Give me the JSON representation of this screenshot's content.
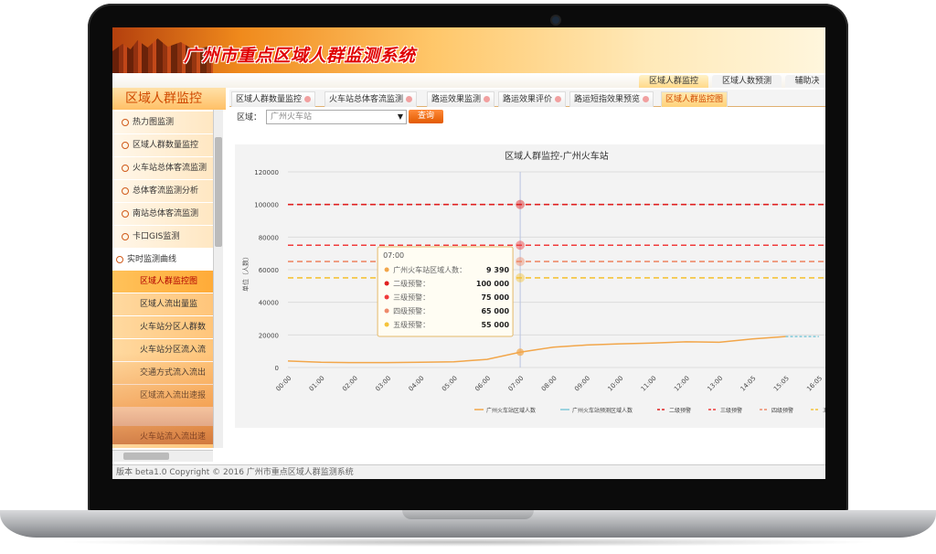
{
  "app": {
    "title": "广州市重点区域人群监测系统",
    "footer": "版本 beta1.0  Copyright © 2016 广州市重点区域人群监测系统"
  },
  "topnav": [
    "区域人群监控",
    "区域人数预测",
    "辅助决"
  ],
  "sidebar": {
    "title": "区域人群监控",
    "items": [
      {
        "label": "热力图监测"
      },
      {
        "label": "区域人群数量监控"
      },
      {
        "label": "火车站总体客流监测"
      },
      {
        "label": "总体客流监测分析"
      },
      {
        "label": "南站总体客流监测"
      },
      {
        "label": "卡口GIS监测"
      },
      {
        "label": "实时监测曲线"
      }
    ],
    "subitems": [
      {
        "label": "区域人群监控图"
      },
      {
        "label": "区域人流出量监"
      },
      {
        "label": "火车站分区人群数"
      },
      {
        "label": "火车站分区流入流"
      },
      {
        "label": "交通方式流入流出"
      },
      {
        "label": "区域流入流出速报"
      },
      {
        "label": "火车站流入流出速"
      }
    ]
  },
  "tabs": [
    "区域人群数量监控",
    "火车站总体客流监测",
    "路运效果监测",
    "路运效果评价",
    "路运短指效果预览",
    "区域人群监控图"
  ],
  "filter": {
    "label": "区域：",
    "value": "广州火车站",
    "button": "查询"
  },
  "chart_data": {
    "type": "line",
    "title": "区域人群监控-广州火车站",
    "ylabel": "单位（人数）",
    "ylim": [
      0,
      120000
    ],
    "yticks": [
      "120000",
      "100000",
      "80000",
      "60000",
      "40000",
      "20000",
      "0"
    ],
    "x": [
      "00:00",
      "01:00",
      "02:00",
      "03:00",
      "04:00",
      "05:00",
      "06:00",
      "07:00",
      "08:00",
      "09:00",
      "10:00",
      "11:00",
      "12:00",
      "13:00",
      "14:05",
      "15:05",
      "16:05"
    ],
    "series": [
      {
        "name": "广州火车站区域人数",
        "color": "#f2a64a",
        "values": [
          4000,
          3200,
          3000,
          3000,
          3200,
          3500,
          5000,
          9390,
          12500,
          13800,
          14500,
          15000,
          15800,
          15500,
          17500,
          19000,
          null
        ]
      },
      {
        "name": "广州火车站预测区域人数",
        "color": "#7ec8d8",
        "values": [
          null,
          null,
          null,
          null,
          null,
          null,
          null,
          null,
          null,
          null,
          null,
          null,
          null,
          null,
          null,
          19000,
          19000
        ]
      }
    ],
    "thresholds": [
      {
        "name": "二级预警",
        "value": 100000,
        "color": "#e02020"
      },
      {
        "name": "三级预警",
        "value": 75000,
        "color": "#f03a3a"
      },
      {
        "name": "四级预警",
        "value": 65000,
        "color": "#ee8a6a"
      },
      {
        "name": "五级预警",
        "value": 55000,
        "color": "#f5c33a"
      }
    ],
    "legend": [
      "广州火车站区域人数",
      "广州火车站预测区域人数",
      "二级预警",
      "三级预警",
      "四级预警",
      "五"
    ],
    "tooltip": {
      "time": "07:00",
      "rows": [
        {
          "label": "广州火车站区域人数：",
          "value": "9 390",
          "color": "#f2a64a"
        },
        {
          "label": "二级预警：",
          "value": "100 000",
          "color": "#e02020"
        },
        {
          "label": "三级预警：",
          "value": "75 000",
          "color": "#f03a3a"
        },
        {
          "label": "四级预警：",
          "value": "65 000",
          "color": "#ee8a6a"
        },
        {
          "label": "五级预警：",
          "value": "55 000",
          "color": "#f5c33a"
        }
      ]
    }
  }
}
